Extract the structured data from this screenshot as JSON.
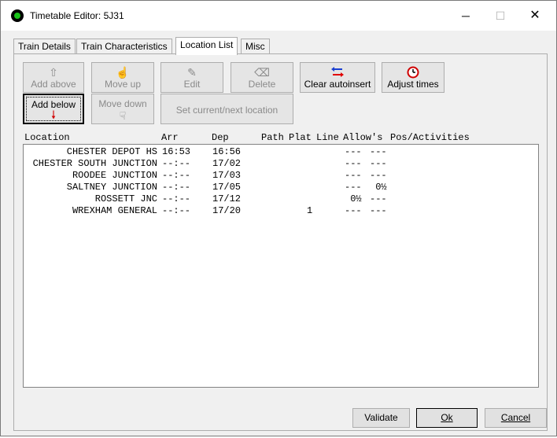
{
  "window": {
    "title": "Timetable Editor: 5J31",
    "minimize_glyph": "─",
    "maximize_glyph": "☐",
    "close_glyph": "✕"
  },
  "tabs": [
    {
      "label": "Train Details"
    },
    {
      "label": "Train Characteristics"
    },
    {
      "label": "Location List"
    },
    {
      "label": "Misc"
    }
  ],
  "toolbar": {
    "add_above": {
      "label": "Add above",
      "icon": "up-arrow-icon",
      "glyph": "⇧"
    },
    "add_below": {
      "label": "Add below",
      "icon": "down-arrow-icon",
      "glyph": "🠗"
    },
    "move_up": {
      "label": "Move up",
      "icon": "hand-up-icon",
      "glyph": "☝"
    },
    "move_down": {
      "label": "Move down",
      "icon": "hand-down-icon",
      "glyph": "☟"
    },
    "edit": {
      "label": "Edit",
      "icon": "edit-icon",
      "glyph": "✎"
    },
    "delete": {
      "label": "Delete",
      "icon": "delete-icon",
      "glyph": "⌫"
    },
    "set_current": {
      "label": "Set current/next location"
    },
    "clear_autoinsert": {
      "label": "Clear autoinsert",
      "icon": "arrows-swap-icon",
      "glyph": "⇆"
    },
    "adjust_times": {
      "label": "Adjust times",
      "icon": "clock-icon",
      "glyph": "⏱"
    }
  },
  "list": {
    "headers": {
      "location": "Location",
      "arr": "Arr",
      "dep": "Dep",
      "path": "Path",
      "plat": "Plat",
      "line": "Line",
      "allows": "Allow's",
      "pos": "Pos/Activities"
    },
    "rows": [
      {
        "location": "CHESTER DEPOT HS",
        "arr": "16:53",
        "dep": "16:56",
        "line": "",
        "allow": "---",
        "pos": "---"
      },
      {
        "location": "CHESTER SOUTH JUNCTION",
        "arr": "--:--",
        "dep": "17/02",
        "line": "",
        "allow": "---",
        "pos": "---"
      },
      {
        "location": "ROODEE JUNCTION",
        "arr": "--:--",
        "dep": "17/03",
        "line": "",
        "allow": "---",
        "pos": "---"
      },
      {
        "location": "SALTNEY JUNCTION",
        "arr": "--:--",
        "dep": "17/05",
        "line": "",
        "allow": "---",
        "pos": " 0½"
      },
      {
        "location": "ROSSETT JNC",
        "arr": "--:--",
        "dep": "17/12",
        "line": "",
        "allow": " 0½",
        "pos": "---"
      },
      {
        "location": "WREXHAM GENERAL",
        "arr": "--:--",
        "dep": "17/20",
        "line": "1",
        "allow": "---",
        "pos": "---"
      }
    ]
  },
  "buttons": {
    "validate": "Validate",
    "ok": "Ok",
    "cancel": "Cancel"
  },
  "colors": {
    "app_icon": "#19c319",
    "clear_autoinsert_red": "#e00000",
    "clear_autoinsert_blue": "#1a3fd1",
    "adjust_times_red": "#d00000"
  }
}
